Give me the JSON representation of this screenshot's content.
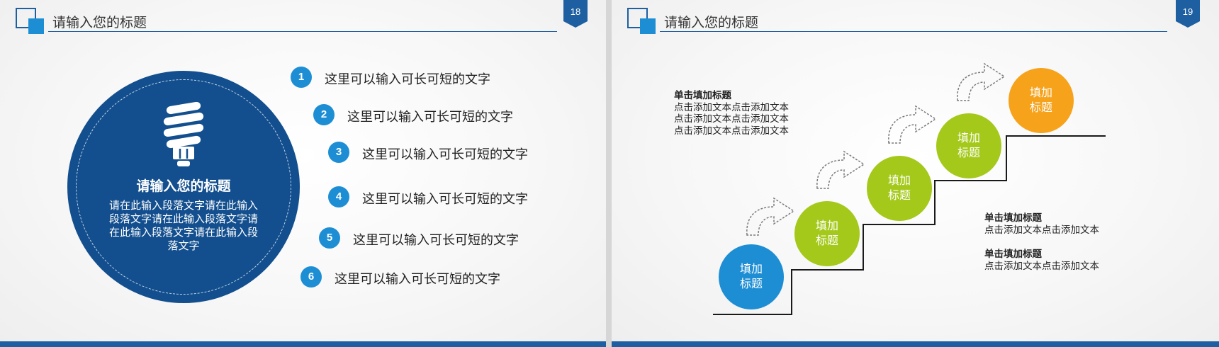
{
  "slide18": {
    "page_number": "18",
    "title": "请输入您的标题",
    "circle_heading": "请输入您的标题",
    "circle_body": "请在此输入段落文字请在此输入段落文字请在此输入段落文字请在此输入段落文字请在此输入段落文字",
    "list": [
      {
        "num": "1",
        "text": "这里可以输入可长可短的文字"
      },
      {
        "num": "2",
        "text": "这里可以输入可长可短的文字"
      },
      {
        "num": "3",
        "text": "这里可以输入可长可短的文字"
      },
      {
        "num": "4",
        "text": "这里可以输入可长可短的文字"
      },
      {
        "num": "5",
        "text": "这里可以输入可长可短的文字"
      },
      {
        "num": "6",
        "text": "这里可以输入可长可短的文字"
      }
    ],
    "icon": "lightbulb-icon"
  },
  "slide19": {
    "page_number": "19",
    "title": "请输入您的标题",
    "top_block": {
      "title": "单击填加标题",
      "lines": [
        "点击添加文本点击添加文本",
        "点击添加文本点击添加文本",
        "点击添加文本点击添加文本"
      ]
    },
    "right_blocks": [
      {
        "title": "单击填加标题",
        "line": "点击添加文本点击添加文本"
      },
      {
        "title": "单击填加标题",
        "line": "点击添加文本点击添加文本"
      }
    ],
    "steps": [
      {
        "label": "填加标题",
        "color": "#1e8ed4"
      },
      {
        "label": "填加标题",
        "color": "#a4c91b"
      },
      {
        "label": "填加标题",
        "color": "#a4c91b"
      },
      {
        "label": "填加标题",
        "color": "#a4c91b"
      },
      {
        "label": "填加标题",
        "color": "#f6a21b"
      }
    ]
  },
  "colors": {
    "primary_dark": "#134f8e",
    "primary": "#1e5fa1",
    "accent_blue": "#1e8ed4",
    "green": "#a4c91b",
    "orange": "#f6a21b"
  }
}
